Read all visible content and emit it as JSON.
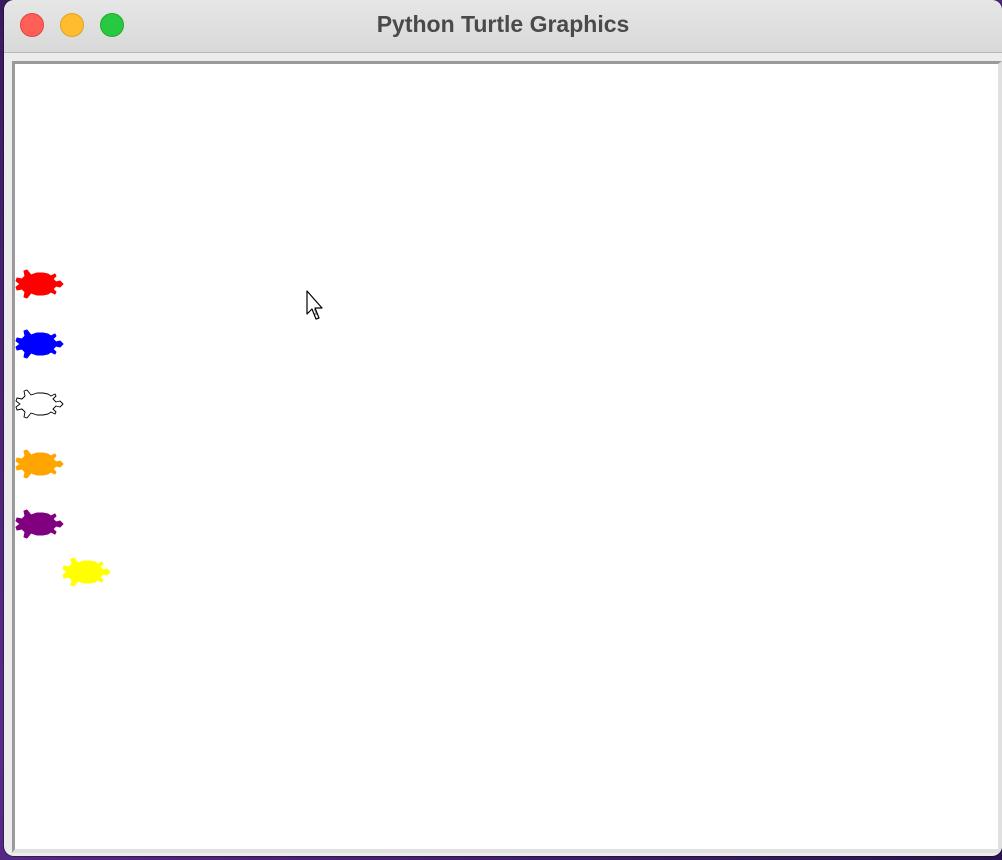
{
  "window": {
    "title": "Python Turtle Graphics"
  },
  "controls": {
    "close": "close",
    "minimize": "minimize",
    "maximize": "maximize"
  },
  "colors": {
    "close": "#ff5f57",
    "minimize": "#febc2e",
    "maximize": "#28c840"
  },
  "turtles": [
    {
      "id": "red",
      "fill": "#ff0000",
      "stroke": "#ff0000"
    },
    {
      "id": "blue",
      "fill": "#0000ff",
      "stroke": "#0000ff"
    },
    {
      "id": "white",
      "fill": "#ffffff",
      "stroke": "#000000"
    },
    {
      "id": "orange",
      "fill": "#ffa500",
      "stroke": "#ffa500"
    },
    {
      "id": "purple",
      "fill": "#800080",
      "stroke": "#800080"
    },
    {
      "id": "yellow",
      "fill": "#ffff00",
      "stroke": "#ffff00"
    }
  ],
  "icons": {
    "cursor": "arrow-cursor-icon"
  }
}
